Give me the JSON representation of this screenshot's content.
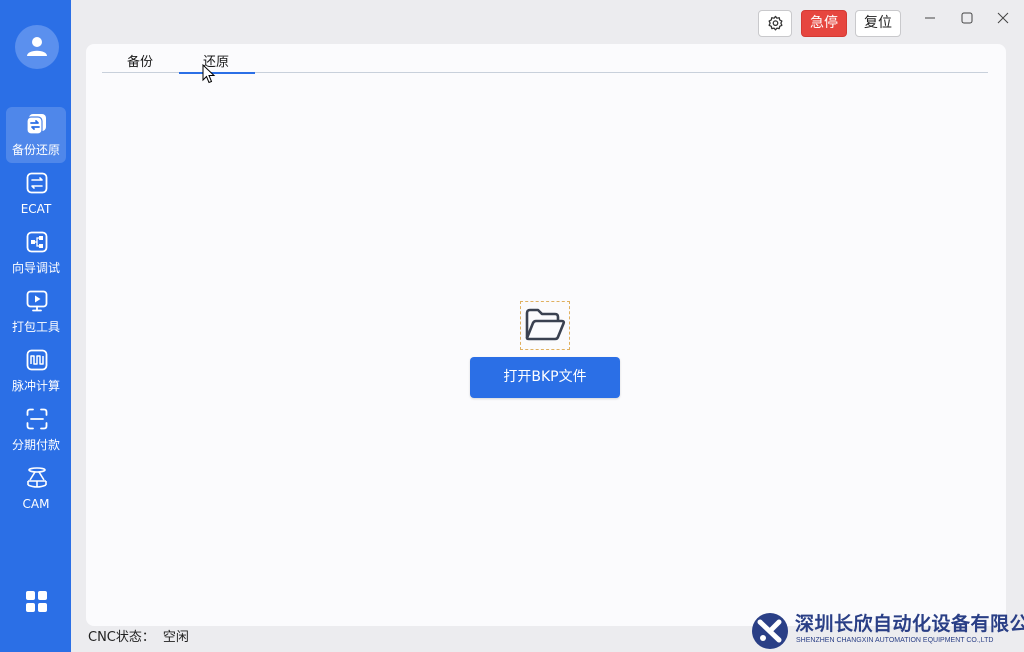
{
  "colors": {
    "accent": "#2b6fe6",
    "danger": "#e6463f",
    "panel_bg": "#fbfbfd",
    "sidebar_bg": "#2b6fe6"
  },
  "sidebar": {
    "avatar_icon": "user-avatar-icon",
    "items": [
      {
        "label": "备份还原",
        "icon": "backup-restore-icon",
        "active": true
      },
      {
        "label": "ECAT",
        "icon": "ecat-icon",
        "active": false
      },
      {
        "label": "向导调试",
        "icon": "wizard-debug-icon",
        "active": false
      },
      {
        "label": "打包工具",
        "icon": "package-tool-icon",
        "active": false
      },
      {
        "label": "脉冲计算",
        "icon": "pulse-calc-icon",
        "active": false
      },
      {
        "label": "分期付款",
        "icon": "installment-icon",
        "active": false
      },
      {
        "label": "CAM",
        "icon": "cam-icon",
        "active": false
      }
    ],
    "bottom_icon": "apps-grid-icon"
  },
  "toolbar": {
    "settings_icon": "gear-icon",
    "estop_label": "急停",
    "reset_label": "复位"
  },
  "tabs": [
    {
      "label": "备份",
      "active": false
    },
    {
      "label": "还原",
      "active": true
    }
  ],
  "restore": {
    "folder_icon": "folder-open-icon",
    "open_button_label": "打开BKP文件"
  },
  "status": {
    "label": "CNC状态：",
    "value": "空闲"
  },
  "watermark": {
    "company_cn": "深圳长欣自动化设备有限公司",
    "company_en": "SHENZHEN CHANGXIN AUTOMATION EQUIPMENT CO.,LTD"
  }
}
